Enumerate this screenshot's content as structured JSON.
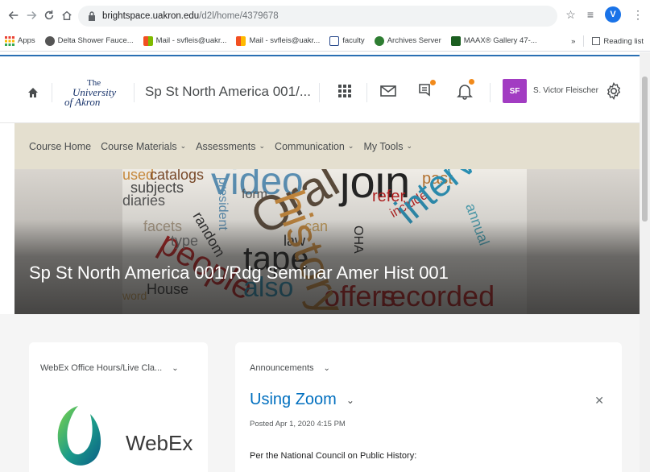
{
  "browser": {
    "url_host": "brightspace.uakron.edu",
    "url_path": "/d2l/home/4379678",
    "profile_initial": "V",
    "bookmarks": [
      {
        "label": "Apps",
        "color": "#ea4335"
      },
      {
        "label": "Delta Shower Fauce...",
        "color": "#555555"
      },
      {
        "label": "Mail - svfleis@uakr...",
        "color": "#f25022"
      },
      {
        "label": "Mail - svfleis@uakr...",
        "color": "#f25022"
      },
      {
        "label": "faculty",
        "color": "#2a4b8d"
      },
      {
        "label": "Archives Server",
        "color": "#2e7d32"
      },
      {
        "label": "MAAX® Gallery 47-...",
        "color": "#1b5e20"
      }
    ],
    "more_label": "»",
    "reading_list": "Reading list"
  },
  "header": {
    "logo_the": "The",
    "logo_university": "University",
    "logo_of_akron": "of Akron",
    "course_title": "Sp St North America 001/...",
    "avatar_initials": "SF",
    "user_name": "S. Victor Fleischer",
    "accent": "#2a6fb3",
    "avatar_color": "#a23cc2",
    "alert_color": "#f18a1b"
  },
  "nav": {
    "items": [
      {
        "label": "Course Home",
        "has_menu": false
      },
      {
        "label": "Course Materials",
        "has_menu": true
      },
      {
        "label": "Assessments",
        "has_menu": true
      },
      {
        "label": "Communication",
        "has_menu": true
      },
      {
        "label": "My Tools",
        "has_menu": true
      }
    ],
    "bg": "#e4dfcf"
  },
  "banner": {
    "title": "Sp St North America 001/Rdg Seminar Amer Hist 001",
    "words": [
      {
        "t": "used",
        "c": "#c98a3c"
      },
      {
        "t": "catalogs",
        "c": "#7a4a2a"
      },
      {
        "t": "video",
        "c": "#5a8fb3"
      },
      {
        "t": "join",
        "c": "#222222"
      },
      {
        "t": "past",
        "c": "#b5722e"
      },
      {
        "t": "subjects",
        "c": "#444444"
      },
      {
        "t": "president",
        "c": "#5a8fb3"
      },
      {
        "t": "form",
        "c": "#555555"
      },
      {
        "t": "refer",
        "c": "#b71c1c"
      },
      {
        "t": "diaries",
        "c": "#555555"
      },
      {
        "t": "random",
        "c": "#333333"
      },
      {
        "t": "Oral",
        "c": "#5a4a3a"
      },
      {
        "t": "include",
        "c": "#b71c1c"
      },
      {
        "t": "annual",
        "c": "#4aa3b5"
      },
      {
        "t": "facets",
        "c": "#b0a08a"
      },
      {
        "t": "people",
        "c": "#b71c1c"
      },
      {
        "t": "can",
        "c": "#c9a05a"
      },
      {
        "t": "OHA",
        "c": "#222222"
      },
      {
        "t": "type",
        "c": "#777777"
      },
      {
        "t": "law",
        "c": "#222222"
      },
      {
        "t": "tape",
        "c": "#222222"
      },
      {
        "t": "interviews",
        "c": "#2a8fb3"
      },
      {
        "t": "House",
        "c": "#333333"
      },
      {
        "t": "also",
        "c": "#2a8fb3"
      },
      {
        "t": "offers",
        "c": "#b71c1c"
      },
      {
        "t": "word",
        "c": "#c9a05a"
      },
      {
        "t": "recorded",
        "c": "#b71c1c"
      },
      {
        "t": "history",
        "c": "#c98a3c"
      }
    ]
  },
  "widgets": {
    "webex": {
      "heading": "WebEx Office Hours/Live Cla...",
      "logo_text": "WebEx"
    },
    "announcements": {
      "heading": "Announcements",
      "item_title": "Using Zoom",
      "posted": "Posted Apr 1, 2020 4:15 PM",
      "body": "Per the National Council on Public History:"
    }
  }
}
